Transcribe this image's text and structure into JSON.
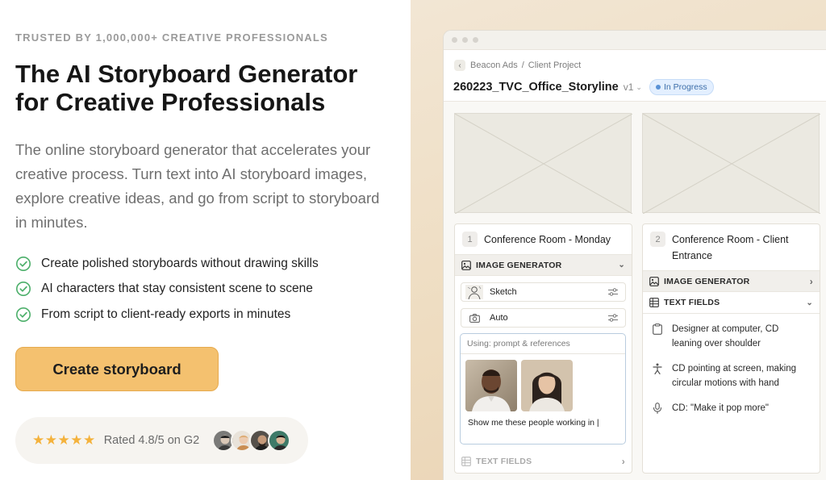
{
  "hero": {
    "eyebrow": "TRUSTED BY 1,000,000+ CREATIVE PROFESSIONALS",
    "title": "The AI Storyboard Generator for Creative Professionals",
    "subtitle": "The online storyboard generator that accelerates your creative process. Turn text into AI storyboard images, explore creative ideas, and go from script to storyboard in minutes.",
    "features": [
      "Create polished storyboards without drawing skills",
      "AI characters that stay consistent scene to scene",
      "From script to client-ready exports in minutes"
    ],
    "cta_label": "Create storyboard",
    "rating": {
      "stars": "★★★★★",
      "text": "Rated 4.8/5 on G2",
      "value": 4.8
    }
  },
  "app": {
    "breadcrumb": {
      "team": "Beacon Ads",
      "separator": "/",
      "project": "Client Project"
    },
    "project_title": "260223_TVC_Office_Storyline",
    "version": "v1",
    "status": "In Progress",
    "scenes": [
      {
        "number": "1",
        "title": "Conference Room - Monday",
        "image_generator_label": "IMAGE GENERATOR",
        "style_option": "Sketch",
        "mode_option": "Auto",
        "using_label": "Using: prompt & references",
        "prompt_text": "Show me these people working in |",
        "text_fields_label": "TEXT FIELDS"
      },
      {
        "number": "2",
        "title": "Conference Room - Client Entrance",
        "image_generator_label": "IMAGE GENERATOR",
        "text_fields_label": "TEXT FIELDS",
        "fields": [
          {
            "icon": "clipboard-icon",
            "text": "Designer at computer, CD leaning over shoulder"
          },
          {
            "icon": "figure-icon",
            "text": "CD pointing at screen, making circular motions with hand"
          },
          {
            "icon": "microphone-icon",
            "text": "CD: \"Make it pop more\""
          }
        ]
      }
    ]
  },
  "colors": {
    "accent": "#f4c16f",
    "status_bg": "#e3efff",
    "check": "#4caf6a",
    "star": "#f4b23c"
  }
}
